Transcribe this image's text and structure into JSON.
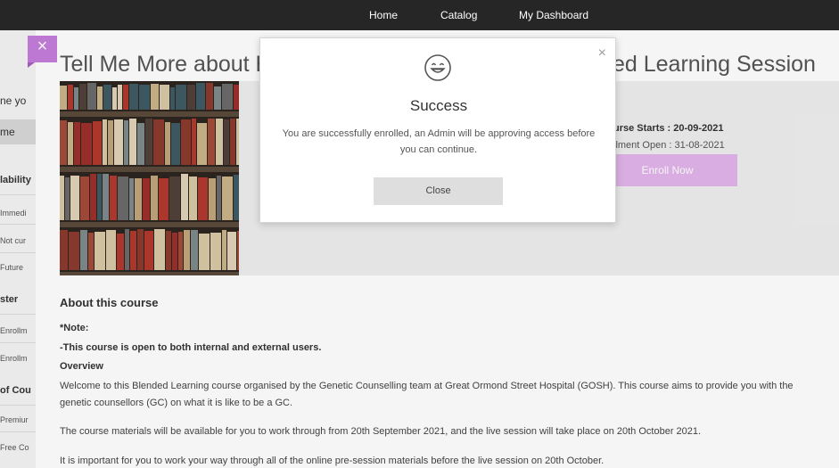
{
  "nav": {
    "home": "Home",
    "catalog": "Catalog",
    "dashboard": "My Dashboard"
  },
  "sidebar": {
    "heading_top": "ne yo",
    "item_home": "me",
    "availability": "lability",
    "avail_1": "Immedi",
    "avail_2": "Not cur",
    "avail_3": "Future",
    "roster": "ster",
    "roster_1": "Enrollm",
    "roster_2": "Enrollm",
    "type": "of Cou",
    "type_1": "Premiur",
    "type_2": "Free Co"
  },
  "course": {
    "title_left": "Tell Me More about E",
    "title_right": "ed Learning Session",
    "starts": "urse Starts : 20-09-2021",
    "enroll_open": "llment Open : 31-08-2021",
    "enroll_button": "Enroll Now",
    "about_heading": "About this course",
    "note": "*Note:",
    "note_line": "-This course is open to both internal and external users.",
    "overview": "Overview",
    "para1_l1": "Welcome to this Blended Learning course organised by the Genetic Counselling team at Great Ormond Street Hospital (GOSH). This course aims to provide you with the",
    "para1_l2": "genetic counsellors (GC) on what it is like to be a GC.",
    "para2": "The course materials will be available for you to work through from 20th September 2021, and the live session will take place on 20th October 2021.",
    "para3": "It is important for you to work your way through all of the online pre-session materials before the live session on 20th October."
  },
  "modal": {
    "title": "Success",
    "message": "You are successfully enrolled, an Admin will be approving access before you can continue.",
    "close_button": "Close",
    "close_x": "×"
  },
  "side_close": "×",
  "colors": {
    "accent": "#c47ddc",
    "enroll": "#e2b5eb",
    "nav": "#262626"
  }
}
